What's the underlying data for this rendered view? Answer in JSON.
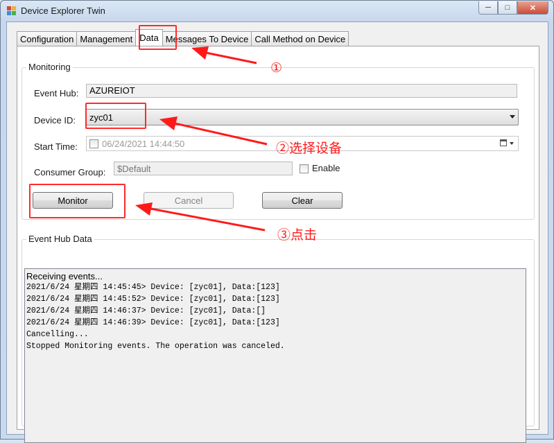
{
  "window": {
    "title": "Device Explorer Twin"
  },
  "tabs": [
    {
      "label": "Configuration"
    },
    {
      "label": "Management"
    },
    {
      "label": "Data"
    },
    {
      "label": "Messages To Device"
    },
    {
      "label": "Call Method on Device"
    }
  ],
  "monitoring": {
    "group_label": "Monitoring",
    "event_hub_label": "Event Hub:",
    "event_hub_value": "AZUREIOT",
    "device_id_label": "Device ID:",
    "device_id_value": "zyc01",
    "start_time_label": "Start Time:",
    "start_time_value": "06/24/2021 14:44:50",
    "consumer_group_label": "Consumer Group:",
    "consumer_group_placeholder": "$Default",
    "enable_label": "Enable",
    "buttons": {
      "monitor": "Monitor",
      "cancel": "Cancel",
      "clear": "Clear"
    }
  },
  "event_hub_data": {
    "group_label": "Event Hub Data",
    "lines": [
      "Receiving events...",
      "2021/6/24 星期四 14:45:45> Device: [zyc01], Data:[123]",
      "2021/6/24 星期四 14:45:52> Device: [zyc01], Data:[123]",
      "2021/6/24 星期四 14:46:37> Device: [zyc01], Data:[]",
      "2021/6/24 星期四 14:46:39> Device: [zyc01], Data:[123]",
      "Cancelling...",
      "Stopped Monitoring events. The operation was canceled."
    ]
  },
  "annotations": {
    "step1": "①",
    "step2": "②选择设备",
    "step3": "③点击",
    "color": "#ff1a1a"
  }
}
